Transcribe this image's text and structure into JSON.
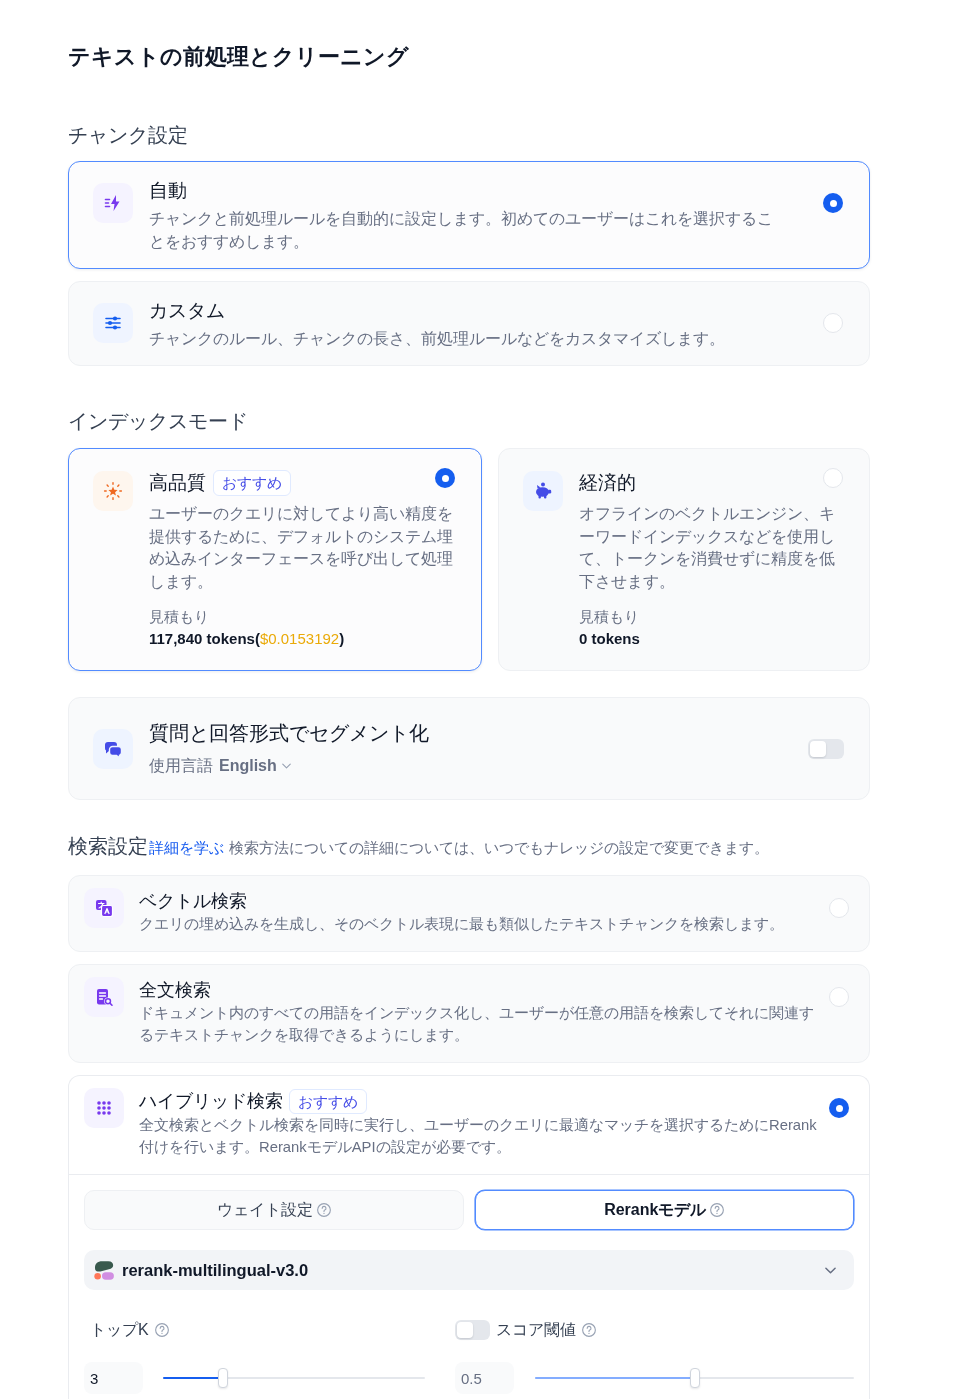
{
  "title": "テキストの前処理とクリーニング",
  "chunk_settings": {
    "heading": "チャンク設定",
    "options": [
      {
        "title": "自動",
        "description": "チャンクと前処理ルールを自動的に設定します。初めてのユーザーはこれを選択することをおすすめします。",
        "selected": true
      },
      {
        "title": "カスタム",
        "description": "チャンクのルール、チャンクの長さ、前処理ルールなどをカスタマイズします。",
        "selected": false
      }
    ]
  },
  "index_mode": {
    "heading": "インデックスモード",
    "options": [
      {
        "title": "高品質",
        "badge": "おすすめ",
        "description": "ユーザーのクエリに対してより高い精度を提供するために、デフォルトのシステム埋め込みインターフェースを呼び出して処理します。",
        "estimate_label": "見積もり",
        "estimate": [
          {
            "kind": "plain",
            "text": "117,840 tokens("
          },
          {
            "kind": "cost",
            "text": "$0.0153192"
          },
          {
            "kind": "plain",
            "text": ")"
          }
        ],
        "selected": true
      },
      {
        "title": "経済的",
        "description": "オフラインのベクトルエンジン、キーワードインデックスなどを使用して、トークンを消費せずに精度を低下させます。",
        "estimate_label": "見積もり",
        "estimate": [
          {
            "kind": "plain",
            "text": "0 tokens"
          }
        ],
        "selected": false
      }
    ]
  },
  "qa_segmentation": {
    "title": "質問と回答形式でセグメント化",
    "language_label": "使用言語",
    "language": "English",
    "on": false
  },
  "retrieval": {
    "heading": "検索設定",
    "link": "詳細を学ぶ",
    "note": "検索方法についての詳細については、いつでもナレッジの設定で変更できます。",
    "options": [
      {
        "title": "ベクトル検索",
        "description": "クエリの埋め込みを生成し、そのベクトル表現に最も類似したテキストチャンクを検索します。",
        "selected": false
      },
      {
        "title": "全文検索",
        "description": "ドキュメント内のすべての用語をインデックス化し、ユーザーが任意の用語を検索してそれに関連するテキストチャンクを取得できるようにします。",
        "selected": false
      },
      {
        "title": "ハイブリッド検索",
        "badge": "おすすめ",
        "description": "全文検索とベクトル検索を同時に実行し、ユーザーのクエリに最適なマッチを選択するためにRerank付けを行います。RerankモデルAPIの設定が必要です。",
        "selected": true,
        "settings": {
          "tabs": [
            {
              "label": "ウェイト設定",
              "selected": false
            },
            {
              "label": "Rerankモデル",
              "selected": true
            }
          ],
          "model": "rerank-multilingual-v3.0",
          "top_k": {
            "label": "トップK",
            "value": "3",
            "level": 0.23
          },
          "score_threshold": {
            "label": "スコア閾値",
            "on": false,
            "value": "0.5",
            "level": 0.5
          }
        }
      }
    ]
  }
}
